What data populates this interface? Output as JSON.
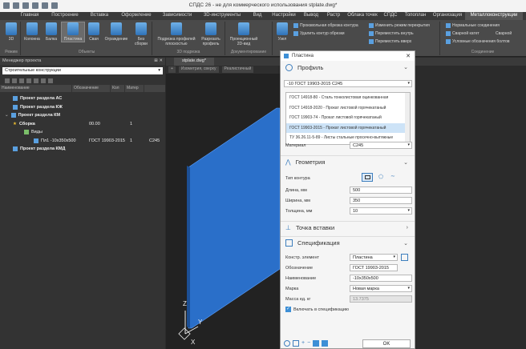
{
  "window": {
    "title": "СПДС 26 - не для коммерческого использования stplate.dwg*"
  },
  "ribbon_tabs": [
    "Главная",
    "Построение",
    "Вставка",
    "Оформление",
    "Зависимости",
    "3D-инструменты",
    "Вид",
    "Настройки",
    "Вывод",
    "Растр",
    "Облака точек",
    "СПДС",
    "Топоплан",
    "Организация",
    "Металлоконструкции"
  ],
  "ribbon": {
    "buttons": {
      "b3d": "3D",
      "column": "Колонна",
      "beam": "Балка",
      "plate": "Пластина",
      "pile": "Свая",
      "fence": "Ограждение",
      "without_assembly": "Без сборки",
      "profile_underlay": "Подрезка профилей плоскостью",
      "cut_profile": "Разрезать профиль",
      "projection_2d": "Проекционный 2D-вид",
      "node": "Узел"
    },
    "small": {
      "arbitrary_cut": "Произвольная обрезка контура",
      "delete_cut": "Удалить контур обрезки",
      "change_overlap": "Изменить режим перекрытия",
      "move_inside": "Переместить внутрь",
      "move_up": "Переместить вверх",
      "normal_connections": "Нормальные соединения",
      "weld_joint": "Сварной катет",
      "weld": "Сварной",
      "conditional_weld": "Условные обозначения болтов"
    },
    "groups": {
      "modes": "Режим",
      "objects": "Объекты",
      "underlay": "3D подрезка",
      "documenting": "Документирование",
      "connections": "Соединение"
    }
  },
  "left_panel": {
    "title": "Менеджер проекта",
    "filter": "Строительные конструкции",
    "columns": [
      "Наименование",
      "Обозначение",
      "Кол",
      "Матер"
    ],
    "tree": [
      {
        "label": "Проект раздела АС",
        "designation": "",
        "qty": "",
        "material": ""
      },
      {
        "label": "Проект раздела КЖ",
        "designation": "",
        "qty": "",
        "material": ""
      },
      {
        "label": "Проект раздела КМ",
        "designation": "",
        "qty": "",
        "material": ""
      },
      {
        "label": "Сборка",
        "designation": "00.00",
        "qty": "1",
        "material": ""
      },
      {
        "label": "Виды",
        "designation": "",
        "qty": "",
        "material": ""
      },
      {
        "label": "Пл1   -10x350x500",
        "designation": "ГОСТ 19903-2015",
        "qty": "1",
        "material": "С245"
      },
      {
        "label": "Проект раздела КМД",
        "designation": "",
        "qty": "",
        "material": ""
      }
    ]
  },
  "doc_tab": "stplate.dwg*",
  "view_bar": [
    "Изометрия, сверху",
    "Реалистичный"
  ],
  "viewport_axis": {
    "z": "Z",
    "y": "Y",
    "x": "X"
  },
  "dialog": {
    "title": "Пластина",
    "sections": {
      "profile": "Профиль",
      "geometry": "Геометрия",
      "insert_point": "Точка вставки",
      "spec": "Спецификация"
    },
    "profile_select": "-10 ГОСТ 19903-2015 С245",
    "profile_list": [
      "ГОСТ 14918-80 - Сталь тонколистовая оцинкованная",
      "ГОСТ 14918-2020 - Прокат листовой горячекатаный",
      "ГОСТ 19903-74 - Прокат листовой горячекатаный",
      "ГОСТ 19903-2015 - Прокат листовой горячекатаный",
      "ТУ 36.26.11-5-89 - Листы стальные просечно-вытяжные"
    ],
    "material_label": "Материал",
    "material_value": "С245",
    "contour_label": "Тип контура",
    "length_label": "Длина, мм",
    "length_value": "500",
    "width_label": "Ширина, мм",
    "width_value": "350",
    "thickness_label": "Толщина, мм",
    "thickness_value": "10",
    "constr_label": "Констр. элемент",
    "constr_value": "Пластина",
    "designation_label": "Обозначение",
    "designation_value": "ГОСТ 19903-2015",
    "name_label": "Наименование",
    "name_value": "-10x350x500",
    "mark_label": "Марка",
    "mark_value": "Новая марка",
    "mass_label": "Масса ед. кг",
    "mass_value": "13.7375",
    "include_label": "Включать в спецификацию",
    "ok": "OK"
  },
  "colors": {
    "plate": "#2a6fc9",
    "accent": "#3d8fd6",
    "selection": "#cde3f7"
  }
}
